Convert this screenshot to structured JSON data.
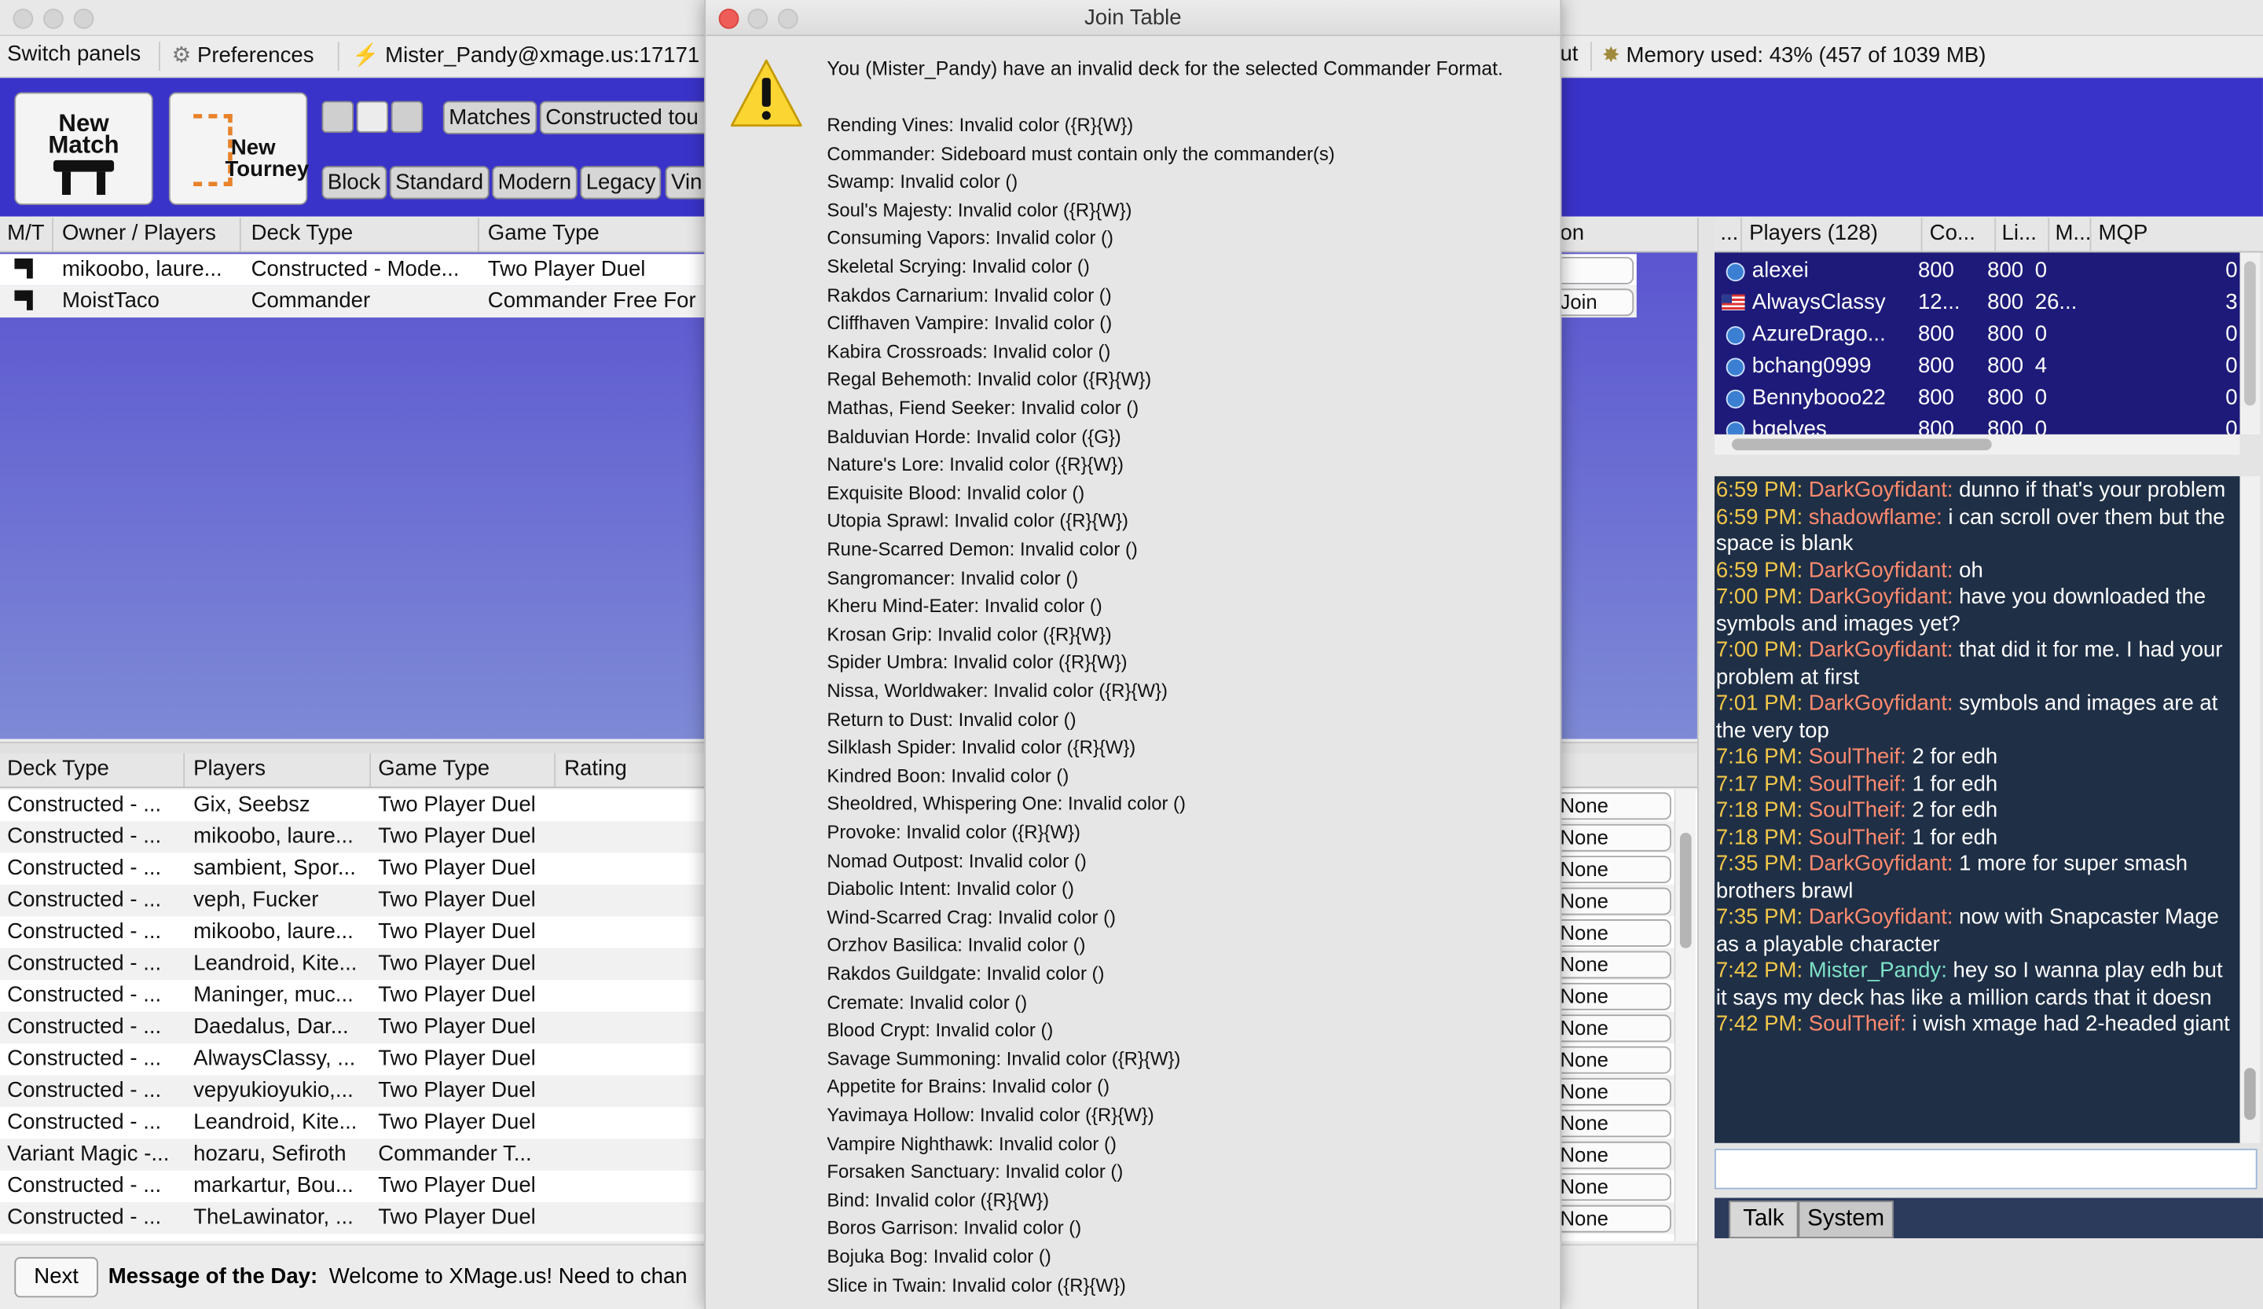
{
  "dialog": {
    "title": "Join Table",
    "message": "You (Mister_Pandy) have an invalid deck for the selected Commander Format.",
    "icon": "warning-icon",
    "errors": [
      "Rending Vines: Invalid color ({R}{W})",
      "Commander: Sideboard must contain only the commander(s)",
      "Swamp: Invalid color ()",
      "Soul's Majesty: Invalid color ({R}{W})",
      "Consuming Vapors: Invalid color ()",
      "Skeletal Scrying: Invalid color ()",
      "Rakdos Carnarium: Invalid color ()",
      "Cliffhaven Vampire: Invalid color ()",
      "Kabira Crossroads: Invalid color ()",
      "Regal Behemoth: Invalid color ({R}{W})",
      "Mathas, Fiend Seeker: Invalid color ()",
      "Balduvian Horde: Invalid color ({G})",
      "Nature's Lore: Invalid color ({R}{W})",
      "Exquisite Blood: Invalid color ()",
      "Utopia Sprawl: Invalid color ({R}{W})",
      "Rune-Scarred Demon: Invalid color ()",
      "Sangromancer: Invalid color ()",
      "Kheru Mind-Eater: Invalid color ()",
      "Krosan Grip: Invalid color ({R}{W})",
      "Spider Umbra: Invalid color ({R}{W})",
      "Nissa, Worldwaker: Invalid color ({R}{W})",
      "Return to Dust: Invalid color ()",
      "Silklash Spider: Invalid color ({R}{W})",
      "Kindred Boon: Invalid color ()",
      "Sheoldred, Whispering One: Invalid color ()",
      "Provoke: Invalid color ({R}{W})",
      "Nomad Outpost: Invalid color ()",
      "Diabolic Intent: Invalid color ()",
      "Wind-Scarred Crag: Invalid color ()",
      "Orzhov Basilica: Invalid color ()",
      "Rakdos Guildgate: Invalid color ()",
      "Cremate: Invalid color ()",
      "Blood Crypt: Invalid color ()",
      "Savage Summoning: Invalid color ({R}{W})",
      "Appetite for Brains: Invalid color ()",
      "Yavimaya Hollow: Invalid color ({R}{W})",
      "Vampire Nighthawk: Invalid color ()",
      "Forsaken Sanctuary: Invalid color ()",
      "Bind: Invalid color ({R}{W})",
      "Boros Garrison: Invalid color ()",
      "Bojuka Bog: Invalid color ()",
      "Slice in Twain: Invalid color ({R}{W})"
    ]
  },
  "toolbar": {
    "switch_panels": "Switch panels",
    "preferences": "Preferences",
    "server": "Mister_Pandy@xmage.us:17171",
    "about_fragment": "ut",
    "memory": "Memory used: 43% (457 of 1039 MB)"
  },
  "header": {
    "new_match_l1": "New",
    "new_match_l2": "Match",
    "new_tourney_l1": "New",
    "new_tourney_l2": "Tourney",
    "filters_row1": [
      "Matches",
      "Constructed tou"
    ],
    "filters_row2": [
      "Block",
      "Standard",
      "Modern",
      "Legacy",
      "Vin"
    ]
  },
  "tables": {
    "columns": [
      "M/T",
      "Owner / Players",
      "Deck Type",
      "Game Type"
    ],
    "col_fragment": "on",
    "rows": [
      {
        "owner": "mikoobo, laure...",
        "deck": "Constructed - Mode...",
        "game": "Two Player Duel",
        "action": ""
      },
      {
        "owner": "MoistTaco",
        "deck": "Commander",
        "game": "Commander Free For",
        "action": "Join"
      }
    ]
  },
  "matches": {
    "columns": [
      "Deck Type",
      "Players",
      "Game Type",
      "Rating"
    ],
    "rows": [
      {
        "deck": "Constructed - ...",
        "players": "Gix, Seebsz",
        "game": "Two Player Duel",
        "action": "None"
      },
      {
        "deck": "Constructed - ...",
        "players": "mikoobo, laure...",
        "game": "Two Player Duel",
        "action": "None"
      },
      {
        "deck": "Constructed - ...",
        "players": "sambient, Spor...",
        "game": "Two Player Duel",
        "action": "None"
      },
      {
        "deck": "Constructed - ...",
        "players": "veph, Fucker",
        "game": "Two Player Duel",
        "action": "None"
      },
      {
        "deck": "Constructed - ...",
        "players": "mikoobo, laure...",
        "game": "Two Player Duel",
        "action": "None"
      },
      {
        "deck": "Constructed - ...",
        "players": "Leandroid, Kite...",
        "game": "Two Player Duel",
        "action": "None"
      },
      {
        "deck": "Constructed - ...",
        "players": "Maninger, muc...",
        "game": "Two Player Duel",
        "action": "None"
      },
      {
        "deck": "Constructed - ...",
        "players": "Daedalus, Dar...",
        "game": "Two Player Duel",
        "action": "None"
      },
      {
        "deck": "Constructed - ...",
        "players": "AlwaysClassy, ...",
        "game": "Two Player Duel",
        "action": "None"
      },
      {
        "deck": "Constructed - ...",
        "players": "vepyukioyukio,...",
        "game": "Two Player Duel",
        "action": "None"
      },
      {
        "deck": "Constructed - ...",
        "players": "Leandroid, Kite...",
        "game": "Two Player Duel",
        "action": "None"
      },
      {
        "deck": "Variant Magic -...",
        "players": "hozaru, Sefiroth",
        "game": "Commander T...",
        "action": "None"
      },
      {
        "deck": "Constructed - ...",
        "players": "markartur, Bou...",
        "game": "Two Player Duel",
        "action": "None"
      },
      {
        "deck": "Constructed - ...",
        "players": "TheLawinator, ...",
        "game": "Two Player Duel",
        "action": "None"
      }
    ]
  },
  "players": {
    "columns": [
      "...",
      "Players (128)",
      "Co...",
      "Li...",
      "M...",
      "MQP"
    ],
    "rows": [
      {
        "name": "alexei",
        "co": "800",
        "li": "800",
        "m": "0",
        "mqp": "0"
      },
      {
        "name": "AlwaysClassy",
        "co": "12...",
        "li": "800",
        "m": "26...",
        "mqp": "3"
      },
      {
        "name": "AzureDrago...",
        "co": "800",
        "li": "800",
        "m": "0",
        "mqp": "0"
      },
      {
        "name": "bchang0999",
        "co": "800",
        "li": "800",
        "m": "4",
        "mqp": "0"
      },
      {
        "name": "Bennybooo22",
        "co": "800",
        "li": "800",
        "m": "0",
        "mqp": "0"
      },
      {
        "name": "bgelves",
        "co": "800",
        "li": "800",
        "m": "0",
        "mqp": "0"
      }
    ]
  },
  "chat": {
    "messages": [
      {
        "time": "6:59 PM:",
        "user": "DarkGoyfidant:",
        "text": "dunno if that's your problem"
      },
      {
        "time": "6:59 PM:",
        "user": "shadowflame:",
        "text": "i can scroll over them but the space is blank"
      },
      {
        "time": "6:59 PM:",
        "user": "DarkGoyfidant:",
        "text": "oh"
      },
      {
        "time": "7:00 PM:",
        "user": "DarkGoyfidant:",
        "text": "have you downloaded the symbols and images yet?"
      },
      {
        "time": "7:00 PM:",
        "user": "DarkGoyfidant:",
        "text": "that did it for me. I had your problem at first"
      },
      {
        "time": "7:01 PM:",
        "user": "DarkGoyfidant:",
        "text": "symbols and images are at the very top"
      },
      {
        "time": "7:16 PM:",
        "user": "SoulTheif:",
        "text": "2 for edh"
      },
      {
        "time": "7:17 PM:",
        "user": "SoulTheif:",
        "text": "1 for edh"
      },
      {
        "time": "7:18 PM:",
        "user": "SoulTheif:",
        "text": "2 for edh"
      },
      {
        "time": "7:18 PM:",
        "user": "SoulTheif:",
        "text": "1 for edh"
      },
      {
        "time": "7:35 PM:",
        "user": "DarkGoyfidant:",
        "text": "1 more for super smash brothers brawl"
      },
      {
        "time": "7:35 PM:",
        "user": "DarkGoyfidant:",
        "text": "now with Snapcaster Mage as a playable character"
      },
      {
        "time": "7:42 PM:",
        "user": "Mister_Pandy:",
        "text": "hey so I wanna play edh but it says my deck has like a million cards that it doesn",
        "self": true
      },
      {
        "time": "7:42 PM:",
        "user": "SoulTheif:",
        "text": "i wish xmage had 2-headed giant"
      }
    ],
    "input_value": "",
    "tabs": [
      "Talk",
      "System"
    ]
  },
  "footer": {
    "next": "Next",
    "motd_label": "Message of the Day:",
    "motd_text": "Welcome to XMage.us! Need to chan"
  },
  "colors": {
    "blue_header": "#3a33c9",
    "panel_gradient_top": "#5b55d0",
    "panel_gradient_bottom": "#7e8ad6",
    "players_bg": "#1d1a7a",
    "chat_bg": "#1f2f46"
  }
}
